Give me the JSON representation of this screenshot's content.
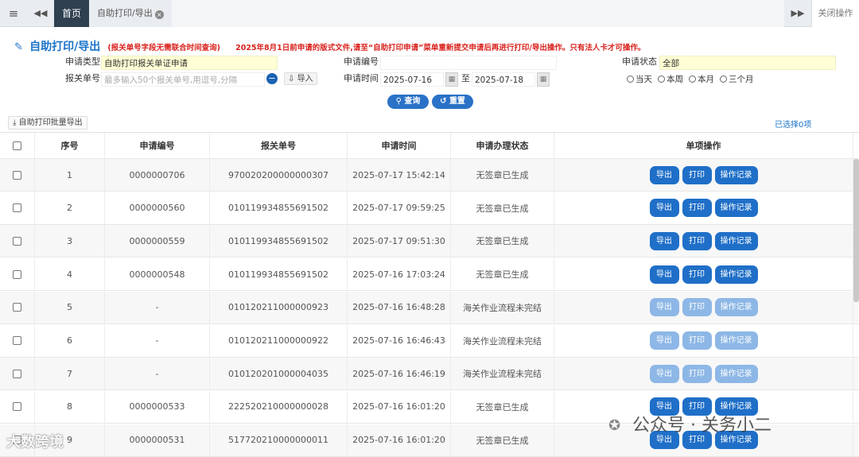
{
  "topbar": {
    "home_tab": "首页",
    "active_tab": "自助打印/导出",
    "close_ops": "关闭操作"
  },
  "heading": {
    "title": "自助打印/导出",
    "note1": "(报关单号字段无需联合时间查询)",
    "note2": "2025年8月1日前申请的版式文件,请至“自助打印申请”菜单重新提交申请后再进行打印/导出操作。只有法人卡才可操作。"
  },
  "form": {
    "apply_type_label": "申请类型",
    "apply_type_value": "自助打印报关单证申请",
    "apply_no_label": "申请编号",
    "apply_no_value": "",
    "status_label": "申请状态",
    "status_value": "全部",
    "decl_no_label": "报关单号",
    "decl_no_placeholder": "最多输入50个报关单号,用逗号,分隔",
    "import_label": "导入",
    "apply_time_label": "申请时间",
    "date_from": "2025-07-16",
    "date_to_sep": "至",
    "date_to": "2025-07-18",
    "radios": [
      "当天",
      "本周",
      "本月",
      "三个月"
    ],
    "query_button": "查询",
    "reset_button": "重置"
  },
  "toolbar": {
    "batch_export": "自助打印批量导出",
    "selected_count": "已选择0项"
  },
  "table": {
    "columns": [
      "序号",
      "申请编号",
      "报关单号",
      "申请时间",
      "申请办理状态",
      "单项操作"
    ],
    "ops": [
      "导出",
      "打印",
      "操作记录"
    ],
    "rows": [
      {
        "seq": "1",
        "apply_no": "0000000706",
        "decl_no": "970020200000000307",
        "time": "2025-07-17 15:42:14",
        "status": "无签章已生成",
        "enabled": true
      },
      {
        "seq": "2",
        "apply_no": "0000000560",
        "decl_no": "010119934855691502",
        "time": "2025-07-17 09:59:25",
        "status": "无签章已生成",
        "enabled": true
      },
      {
        "seq": "3",
        "apply_no": "0000000559",
        "decl_no": "010119934855691502",
        "time": "2025-07-17 09:51:30",
        "status": "无签章已生成",
        "enabled": true
      },
      {
        "seq": "4",
        "apply_no": "0000000548",
        "decl_no": "010119934855691502",
        "time": "2025-07-16 17:03:24",
        "status": "无签章已生成",
        "enabled": true
      },
      {
        "seq": "5",
        "apply_no": "-",
        "decl_no": "010120211000000923",
        "time": "2025-07-16 16:48:28",
        "status": "海关作业流程未完结",
        "enabled": false
      },
      {
        "seq": "6",
        "apply_no": "-",
        "decl_no": "010120211000000922",
        "time": "2025-07-16 16:46:43",
        "status": "海关作业流程未完结",
        "enabled": false
      },
      {
        "seq": "7",
        "apply_no": "-",
        "decl_no": "010120201000004035",
        "time": "2025-07-16 16:46:19",
        "status": "海关作业流程未完结",
        "enabled": false
      },
      {
        "seq": "8",
        "apply_no": "0000000533",
        "decl_no": "222520210000000028",
        "time": "2025-07-16 16:01:20",
        "status": "无签章已生成",
        "enabled": true
      },
      {
        "seq": "9",
        "apply_no": "0000000531",
        "decl_no": "517720210000000011",
        "time": "2025-07-16 16:01:20",
        "status": "无签章已生成",
        "enabled": true
      }
    ]
  },
  "watermarks": {
    "left": "大数跨境",
    "right": "公众号 · 关务小二"
  },
  "colors": {
    "accent": "#1a73c9",
    "warning": "#d9231e",
    "button": "#1f6fc8",
    "button_disabled": "#8db7e6",
    "highlight_field": "#ffffd5"
  }
}
